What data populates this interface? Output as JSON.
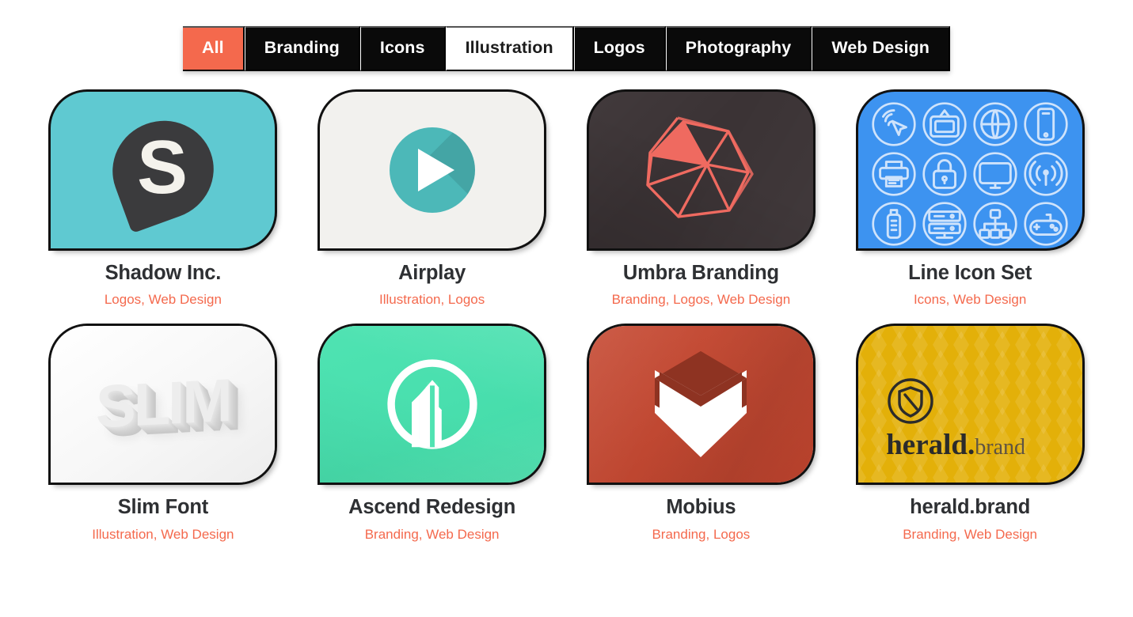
{
  "filter_bar": {
    "tabs": [
      {
        "label": "All",
        "state": "active"
      },
      {
        "label": "Branding",
        "state": "default"
      },
      {
        "label": "Icons",
        "state": "default"
      },
      {
        "label": "Illustration",
        "state": "hover"
      },
      {
        "label": "Logos",
        "state": "default"
      },
      {
        "label": "Photography",
        "state": "default"
      },
      {
        "label": "Web Design",
        "state": "default"
      }
    ]
  },
  "colors": {
    "accent": "#f4694d",
    "tab_bg": "#0a0a0a",
    "title": "#2e3033",
    "page_bg": "#ffffff"
  },
  "gallery": {
    "projects": [
      {
        "title": "Shadow Inc.",
        "tags": "Logos, Web Design",
        "thumb_style": "bg-shadow",
        "monogram": "S"
      },
      {
        "title": "Airplay",
        "tags": "Illustration, Logos",
        "thumb_style": "bg-airplay"
      },
      {
        "title": "Umbra Branding",
        "tags": "Branding, Logos, Web Design",
        "thumb_style": "bg-umbra"
      },
      {
        "title": "Line Icon Set",
        "tags": "Icons, Web Design",
        "thumb_style": "bg-icons",
        "icons": [
          "cursor-click-icon",
          "television-icon",
          "globe-icon",
          "smartphone-icon",
          "printer-icon",
          "lock-icon",
          "monitor-icon",
          "wifi-signal-icon",
          "usb-drive-icon",
          "server-icon",
          "sitemap-icon",
          "gamepad-icon"
        ]
      },
      {
        "title": "Slim Font",
        "tags": "Illustration, Web Design",
        "thumb_style": "bg-slim",
        "display_text": "SLIM"
      },
      {
        "title": "Ascend Redesign",
        "tags": "Branding, Web Design",
        "thumb_style": "bg-ascend"
      },
      {
        "title": "Mobius",
        "tags": "Branding, Logos",
        "thumb_style": "bg-mobius"
      },
      {
        "title": "herald.brand",
        "tags": "Branding, Web Design",
        "thumb_style": "bg-herald",
        "wordmark_dark": "herald.",
        "wordmark_light": "brand"
      }
    ]
  }
}
